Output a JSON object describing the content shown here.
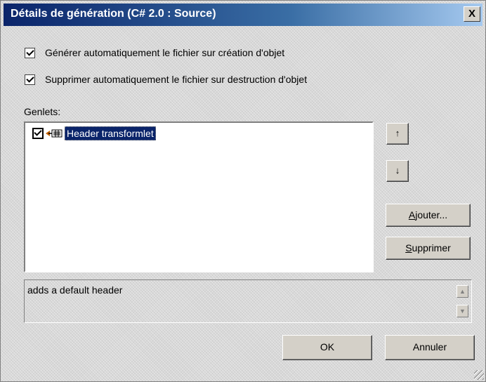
{
  "window": {
    "title": "Détails de génération (C# 2.0 : Source)",
    "close_glyph": "X"
  },
  "options": {
    "auto_generate_label": "Générer automatiquement le fichier sur création d'objet",
    "auto_generate_checked": true,
    "auto_delete_label": "Supprimer automatiquement le fichier sur destruction d'objet",
    "auto_delete_checked": true
  },
  "genlets": {
    "label": "Genlets:",
    "items": [
      {
        "label": "Header transformlet",
        "checked": true,
        "selected": true,
        "icon": "transformlet-icon"
      }
    ]
  },
  "buttons": {
    "move_up_glyph": "↑",
    "move_down_glyph": "↓",
    "add_label": "Ajouter...",
    "add_mnemonic": "A",
    "remove_label": "Supprimer",
    "remove_mnemonic": "S",
    "ok_label": "OK",
    "cancel_label": "Annuler"
  },
  "description": {
    "text": "adds a default header",
    "scroll_up_glyph": "▲",
    "scroll_down_glyph": "▼"
  },
  "colors": {
    "titlebar_start": "#0a246a",
    "titlebar_end": "#a6caf0",
    "selection": "#0a246a",
    "face": "#d4d0c8"
  }
}
